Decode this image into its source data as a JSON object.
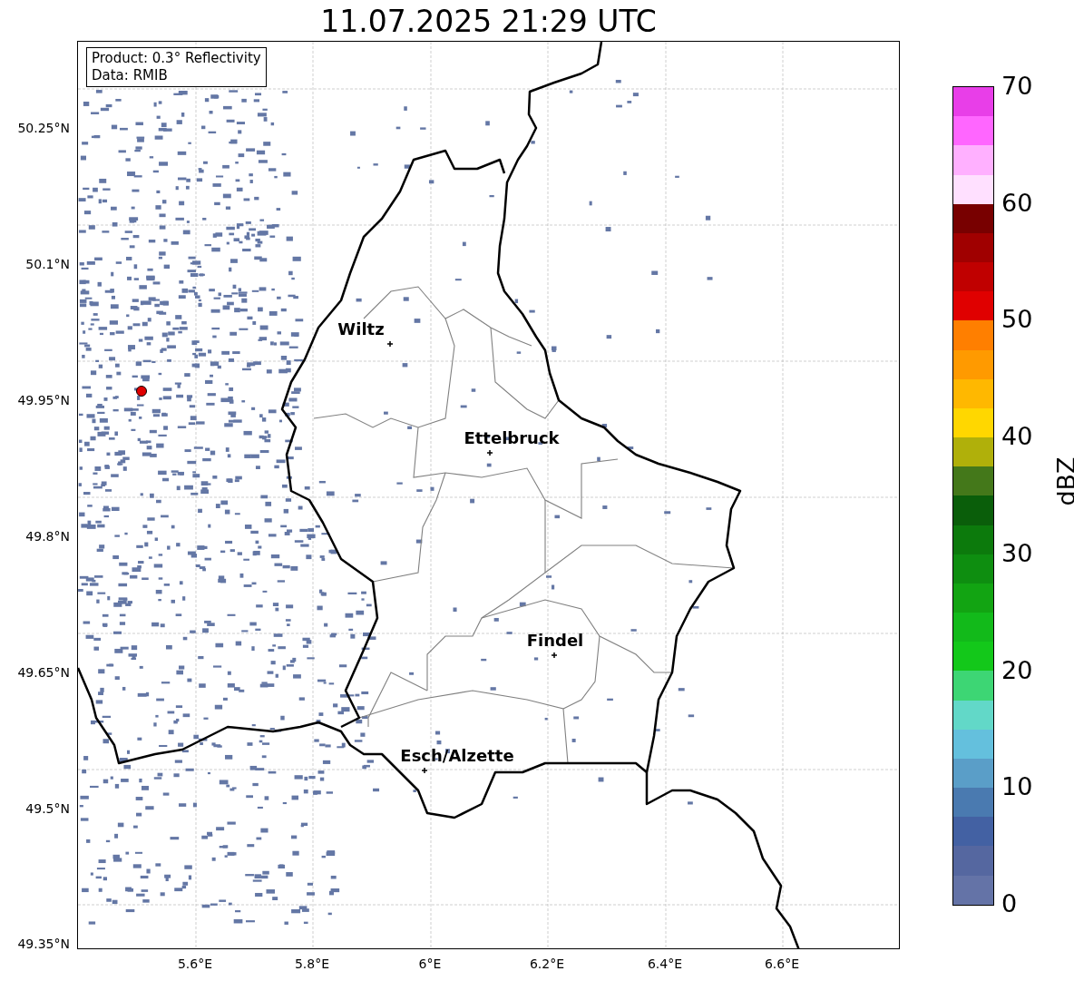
{
  "title": "11.07.2025 21:29 UTC",
  "map": {
    "info_lines": [
      "Product: 0.3° Reflectivity",
      "Data: RMIB"
    ],
    "yticks": [
      "50.25°N",
      "50.1°N",
      "49.95°N",
      "49.8°N",
      "49.65°N",
      "49.5°N",
      "49.35°N"
    ],
    "xticks": [
      "5.6°E",
      "5.8°E",
      "6°E",
      "6.2°E",
      "6.4°E",
      "6.6°E"
    ],
    "cities": [
      {
        "name": "Wiltz"
      },
      {
        "name": "Ettelbruck"
      },
      {
        "name": "Findel"
      },
      {
        "name": "Esch/Alzette"
      }
    ]
  },
  "colorbar": {
    "label": "dBZ",
    "ticks": [
      "70",
      "60",
      "50",
      "40",
      "30",
      "20",
      "10",
      "0"
    ],
    "levels": [
      {
        "color": "#e83ee8"
      },
      {
        "color": "#ff66ff"
      },
      {
        "color": "#ffb0ff"
      },
      {
        "color": "#ffe0ff"
      },
      {
        "color": "#780000"
      },
      {
        "color": "#a00000"
      },
      {
        "color": "#c00000"
      },
      {
        "color": "#e00000"
      },
      {
        "color": "#ff7f00"
      },
      {
        "color": "#ff9a00"
      },
      {
        "color": "#ffb800"
      },
      {
        "color": "#ffd700"
      },
      {
        "color": "#b0b00a"
      },
      {
        "color": "#44781a"
      },
      {
        "color": "#0a5e0a"
      },
      {
        "color": "#0c7a0c"
      },
      {
        "color": "#0e8e10"
      },
      {
        "color": "#12a412"
      },
      {
        "color": "#12ba1a"
      },
      {
        "color": "#13c81a"
      },
      {
        "color": "#3dd674"
      },
      {
        "color": "#62d8c8"
      },
      {
        "color": "#64c0dd"
      },
      {
        "color": "#5a9ec8"
      },
      {
        "color": "#4a7ab0"
      },
      {
        "color": "#4361a3"
      },
      {
        "color": "#5567a0"
      },
      {
        "color": "#6473a7"
      }
    ]
  }
}
